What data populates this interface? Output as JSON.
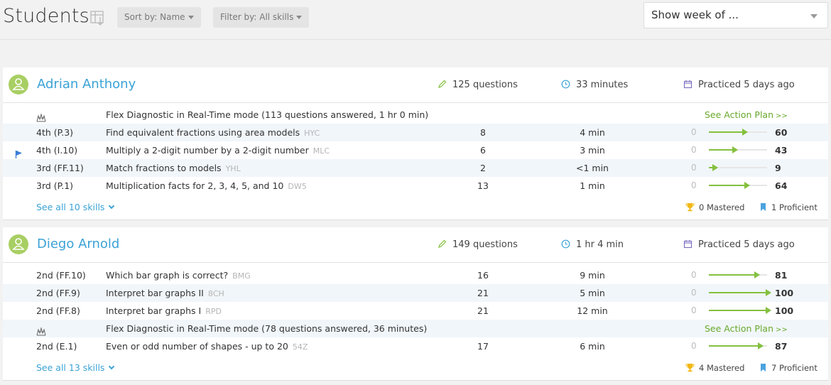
{
  "header": {
    "title": "Students",
    "sort_label": "Sort by: Name",
    "filter_label": "Filter by: All skills",
    "week_select": "Show week of ..."
  },
  "students": [
    {
      "name": "Adrian Anthony",
      "questions": "125 questions",
      "time": "33 minutes",
      "practiced": "Practiced 5 days ago",
      "rows": [
        {
          "kind": "diagnostic",
          "text": "Flex Diagnostic in Real-Time mode (113 questions answered, 1 hr 0 min)",
          "action": "See Action Plan",
          "action_suffix": ">>"
        },
        {
          "kind": "skill",
          "code": "4th (P.3)",
          "skill": "Find equivalent fractions using area models",
          "tag": "HYC",
          "questions": "8",
          "time": "4 min",
          "start": "0",
          "score": "60",
          "score_value": 60
        },
        {
          "kind": "skill",
          "flagged": true,
          "code": "4th (I.10)",
          "skill": "Multiply a 2-digit number by a 2-digit number",
          "tag": "MLC",
          "questions": "6",
          "time": "3 min",
          "start": "0",
          "score": "43",
          "score_value": 43
        },
        {
          "kind": "skill",
          "code": "3rd (FF.11)",
          "skill": "Match fractions to models",
          "tag": "YHL",
          "questions": "2",
          "time": "<1 min",
          "start": "0",
          "score": "9",
          "score_value": 9
        },
        {
          "kind": "skill",
          "code": "3rd (P.1)",
          "skill": "Multiplication facts for 2, 3, 4, 5, and 10",
          "tag": "DW5",
          "questions": "13",
          "time": "1 min",
          "start": "0",
          "score": "64",
          "score_value": 64
        }
      ],
      "see_all": "See all 10 skills",
      "mastered": "0 Mastered",
      "proficient": "1 Proficient"
    },
    {
      "name": "Diego Arnold",
      "questions": "149 questions",
      "time": "1 hr 4 min",
      "practiced": "Practiced 5 days ago",
      "rows": [
        {
          "kind": "skill",
          "code": "2nd (FF.10)",
          "skill": "Which bar graph is correct?",
          "tag": "BMG",
          "questions": "16",
          "time": "9 min",
          "start": "0",
          "score": "81",
          "score_value": 81
        },
        {
          "kind": "skill",
          "code": "2nd (FF.9)",
          "skill": "Interpret bar graphs II",
          "tag": "8CH",
          "questions": "21",
          "time": "5 min",
          "start": "0",
          "score": "100",
          "score_value": 100
        },
        {
          "kind": "skill",
          "code": "2nd (FF.8)",
          "skill": "Interpret bar graphs I",
          "tag": "RPD",
          "questions": "21",
          "time": "12 min",
          "start": "0",
          "score": "100",
          "score_value": 100
        },
        {
          "kind": "diagnostic",
          "text": "Flex Diagnostic in Real-Time mode (78 questions answered, 36 minutes)",
          "action": "See Action Plan",
          "action_suffix": ">>"
        },
        {
          "kind": "skill",
          "code": "2nd (E.1)",
          "skill": "Even or odd number of shapes - up to 20",
          "tag": "54Z",
          "questions": "17",
          "time": "6 min",
          "start": "0",
          "score": "87",
          "score_value": 87
        }
      ],
      "see_all": "See all 13 skills",
      "mastered": "4 Mastered",
      "proficient": "7 Proficient"
    }
  ],
  "icons": {
    "export": "export-icon",
    "avatar": "person-icon",
    "questions": "pencil-icon",
    "time": "clock-icon",
    "practiced": "calendar-icon",
    "diagnostic": "diagnostic-icon",
    "flag": "flag-icon",
    "mastered": "trophy-icon",
    "proficient": "bookmark-icon",
    "see_all": "chevron-down-icon"
  },
  "colors": {
    "link": "#3aa2d6",
    "progress": "#84c03e",
    "action_plan": "#68a82b",
    "avatar": "#a8cf63",
    "row_alt": "#f1f6fa",
    "trophy": "#f2b818",
    "bookmark": "#4aa3df"
  }
}
